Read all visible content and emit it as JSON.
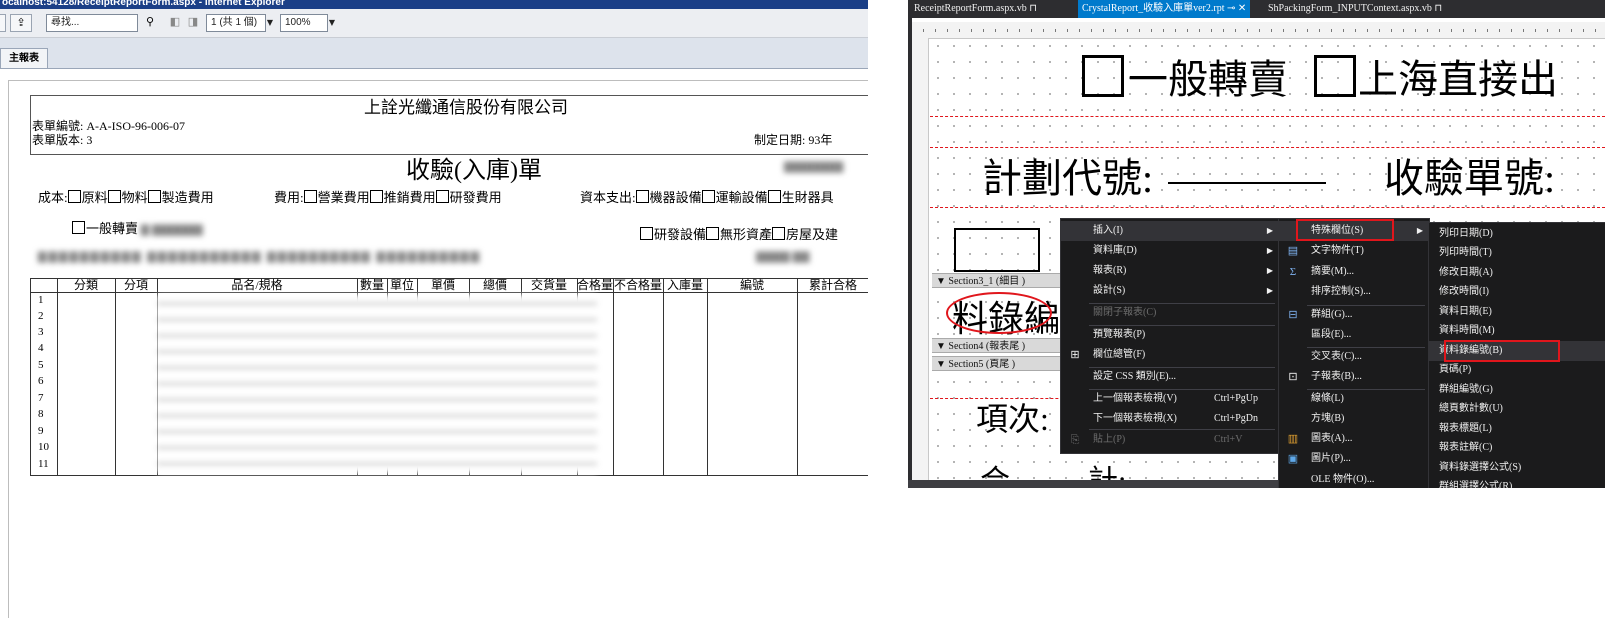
{
  "ie": {
    "title": "ocalhost:54128/ReceiptReportForm.aspx - Internet Explorer",
    "search_placeholder": "尋找...",
    "page_select": "1 (共 1 個)",
    "zoom": "100%",
    "tab_main": "主報表"
  },
  "report": {
    "company": "上詮光纖通信股份有限公司",
    "form_no": "表單編號: A-A-ISO-96-006-07",
    "form_ver": "表單版本: 3",
    "made_date": "制定日期:  93年",
    "title": "收驗(入庫)單",
    "cost_label": "成本:",
    "cost_items": [
      "原料",
      "物料",
      "製造費用"
    ],
    "expense_label": "費用:",
    "expense_items": [
      "營業費用",
      "推銷費用",
      "研發費用"
    ],
    "capital_label": "資本支出:",
    "capital_items": [
      "機器設備",
      "運輸設備",
      "生財器具"
    ],
    "resale_item": "一般轉賣",
    "rd_items": [
      "研發設備",
      "無形資產",
      "房屋及建"
    ],
    "columns": [
      "分類",
      "分項",
      "品名/規格",
      "數量",
      "單位",
      "單價",
      "總價",
      "交貨量",
      "合格量",
      "不合格量",
      "入庫量",
      "編號",
      "累計合格"
    ],
    "row_numbers": [
      "1",
      "2",
      "3",
      "4",
      "5",
      "6",
      "7",
      "8",
      "9",
      "10",
      "11"
    ]
  },
  "vs": {
    "tabs": [
      "ReceiptReportForm.aspx.vb",
      "CrystalReport_收驗入庫單ver2.rpt",
      "ShPackingForm_INPUTContext.aspx.vb"
    ],
    "design_text": {
      "resale": "一般轉賣",
      "shanghai": "上海直接出",
      "plan_code": "計劃代號:",
      "receipt_no": "收驗單號:",
      "record_no": "料錄編",
      "item_no": "項次:",
      "total": "合",
      "total2": "計:"
    },
    "sections": [
      "Section3_1 (細目 )",
      "Section4 (報表尾 )",
      "Section5 (頁尾 )"
    ],
    "context_menu": [
      {
        "label": "插入(I)",
        "arrow": true
      },
      {
        "label": "資料庫(D)",
        "arrow": true
      },
      {
        "label": "報表(R)",
        "arrow": true
      },
      {
        "label": "設計(S)",
        "arrow": true
      },
      {
        "label": "關閉子報表(C)",
        "disabled": true
      },
      {
        "label": "預覽報表(P)"
      },
      {
        "label": "欄位總管(F)"
      },
      {
        "label": "設定 CSS 類別(E)..."
      },
      {
        "label": "上一個報表檢視(V)",
        "shortcut": "Ctrl+PgUp"
      },
      {
        "label": "下一個報表檢視(X)",
        "shortcut": "Ctrl+PgDn"
      },
      {
        "label": "貼上(P)",
        "shortcut": "Ctrl+V",
        "disabled": true
      }
    ],
    "insert_menu": [
      "特殊欄位(S)",
      "文字物件(T)",
      "摘要(M)...",
      "排序控制(S)...",
      "群組(G)...",
      "區段(E)...",
      "交叉表(C)...",
      "子報表(B)...",
      "線條(L)",
      "方塊(B)",
      "圖表(A)...",
      "圖片(P)...",
      "OLE 物件(O)..."
    ],
    "special_fields": [
      "列印日期(D)",
      "列印時間(T)",
      "修改日期(A)",
      "修改時間(I)",
      "資料日期(E)",
      "資料時間(M)",
      "資料錄編號(B)",
      "頁碼(P)",
      "群組編號(G)",
      "總頁數計數(U)",
      "報表標題(L)",
      "報表註解(C)",
      "資料錄選擇公式(S)",
      "群組選擇公式(R)"
    ]
  },
  "colors": {
    "vs_dark": "#1b1b1c",
    "vs_accent": "#007acc",
    "highlight_red": "#e0161c",
    "ie_title": "#1b3f87"
  }
}
